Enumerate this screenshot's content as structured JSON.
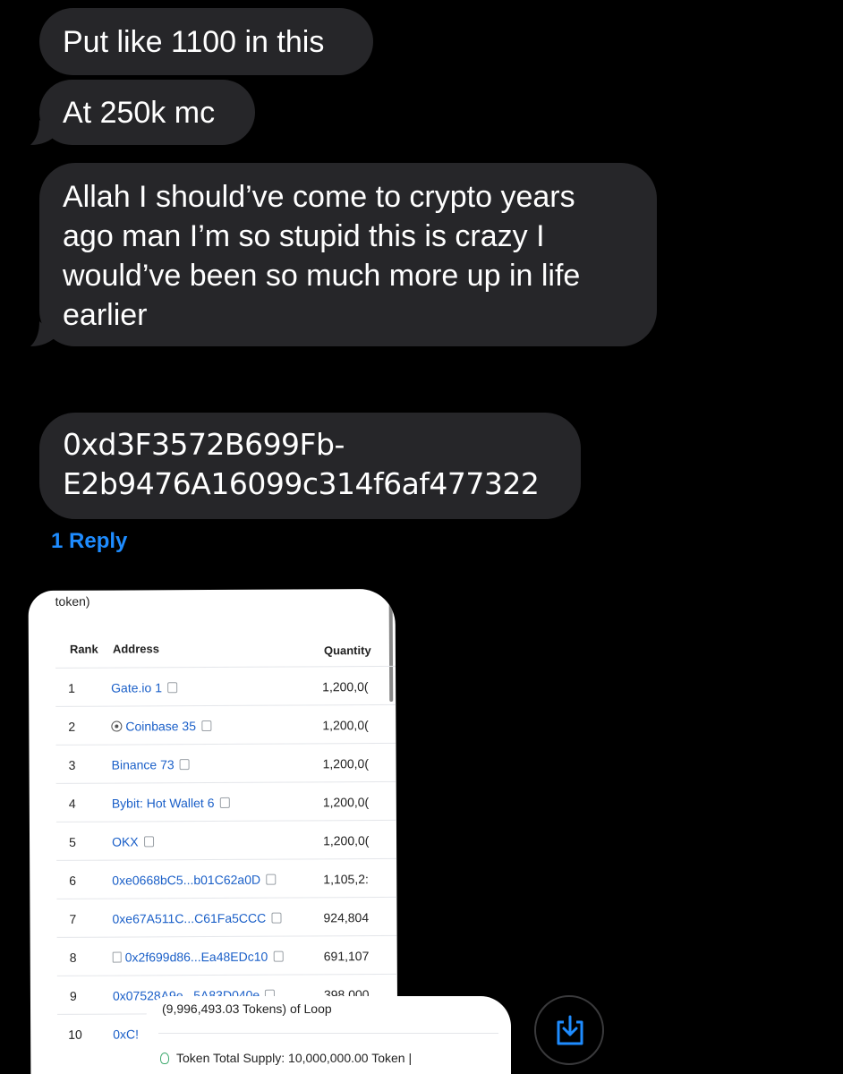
{
  "messages": [
    {
      "text": "Put like 1100 in this"
    },
    {
      "text": "At 250k mc"
    },
    {
      "lines": [
        "Allah I should’ve come to crypto years",
        "ago man I’m so stupid this is crazy I",
        "would’ve been so much more up in life",
        "earlier"
      ]
    },
    {
      "lines": [
        "0xd3F3572B699Fb-",
        "E2b9476A16099c314f6af477322"
      ]
    }
  ],
  "reply_link": "1 Reply",
  "screenshot": {
    "top_label": "token)",
    "columns": {
      "rank": "Rank",
      "address": "Address",
      "quantity": "Quantity"
    },
    "rows": [
      {
        "rank": "1",
        "address": "Gate.io 1",
        "quantity": "1,200,0("
      },
      {
        "rank": "2",
        "address": "Coinbase 35",
        "quantity": "1,200,0("
      },
      {
        "rank": "3",
        "address": "Binance 73",
        "quantity": "1,200,0("
      },
      {
        "rank": "4",
        "address": "Bybit: Hot Wallet 6",
        "quantity": "1,200,0("
      },
      {
        "rank": "5",
        "address": "OKX",
        "quantity": "1,200,0("
      },
      {
        "rank": "6",
        "address": "0xe0668bC5...b01C62a0D",
        "quantity": "1,105,2:"
      },
      {
        "rank": "7",
        "address": "0xe67A511C...C61Fa5CCC",
        "quantity": "924,804"
      },
      {
        "rank": "8",
        "address": "0x2f699d86...Ea48EDc10",
        "quantity": "691,107"
      },
      {
        "rank": "9",
        "address": "0x07528A9e...5A83D040e",
        "quantity": "398,000"
      },
      {
        "rank": "10",
        "address": "0xC!",
        "quantity": ""
      }
    ]
  },
  "screenshot2": {
    "line1": "(9,996,493.03 Tokens) of Loop",
    "line2": "Token Total Supply: 10,000,000.00 Token  |"
  },
  "colors": {
    "bubble": "#262629",
    "link": "#1e8cff",
    "save_icon": "#1e8cff"
  },
  "icons": {
    "save": "download-tray-icon"
  }
}
